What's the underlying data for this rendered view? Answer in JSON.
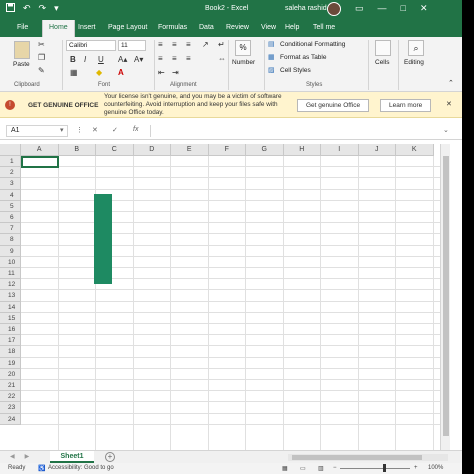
{
  "titlebar": {
    "doc_title": "Book2 - Excel",
    "user": "saleha rashid",
    "save_icon": "save-icon",
    "undo_glyph": "↶",
    "redo_glyph": "↷",
    "customize_glyph": "▾",
    "restore_glyph": "▭",
    "minimize_glyph": "—",
    "maximize_glyph": "□",
    "close_glyph": "✕"
  },
  "ribbon_tabs": [
    {
      "label": "File"
    },
    {
      "label": "Home"
    },
    {
      "label": "Insert"
    },
    {
      "label": "Page Layout"
    },
    {
      "label": "Formulas"
    },
    {
      "label": "Data"
    },
    {
      "label": "Review"
    },
    {
      "label": "View"
    },
    {
      "label": "Help"
    },
    {
      "label": "Tell me"
    }
  ],
  "ribbon": {
    "paste_label": "Paste",
    "clipboard_label": "Clipboard",
    "font_name": "Calibri",
    "font_size": "11",
    "font_label": "Font",
    "bold": "B",
    "italic": "I",
    "underline": "U",
    "font_color_glyph": "A",
    "alignment_label": "Alignment",
    "number_label": "Number",
    "number_symbol": "%",
    "conditional_formatting": "Conditional Formatting",
    "format_as_table": "Format as Table",
    "cell_styles": "Cell Styles",
    "styles_label": "Styles",
    "cells_label": "Cells",
    "editing_label": "Editing"
  },
  "notification": {
    "title": "GET GENUINE OFFICE",
    "message": "Your license isn't genuine, and you may be a victim of software counterfeiting. Avoid interruption and keep your files safe with genuine Office today.",
    "primary_button": "Get genuine Office",
    "secondary_button": "Learn more",
    "close_glyph": "✕"
  },
  "formula_bar": {
    "name_box": "A1",
    "cancel_glyph": "✕",
    "enter_glyph": "✓",
    "fx_glyph": "fx"
  },
  "grid": {
    "columns": [
      "A",
      "B",
      "C",
      "D",
      "E",
      "F",
      "G",
      "H",
      "I",
      "J",
      "K"
    ],
    "rows": [
      "1",
      "2",
      "3",
      "4",
      "5",
      "6",
      "7",
      "8",
      "9",
      "10",
      "11",
      "12",
      "13",
      "14",
      "15",
      "16",
      "17",
      "18",
      "19",
      "20",
      "21",
      "22",
      "23",
      "24"
    ],
    "shape_color": "#1e8a62"
  },
  "sheets": {
    "tabs": [
      "Sheet1"
    ],
    "add_glyph": "+"
  },
  "status": {
    "ready": "Ready",
    "accessibility": "Accessibility: Good to go",
    "zoom_minus": "−",
    "zoom_plus": "+",
    "zoom": "100%"
  },
  "colors": {
    "accent": "#217346",
    "notification_bg": "#fff4ce"
  }
}
